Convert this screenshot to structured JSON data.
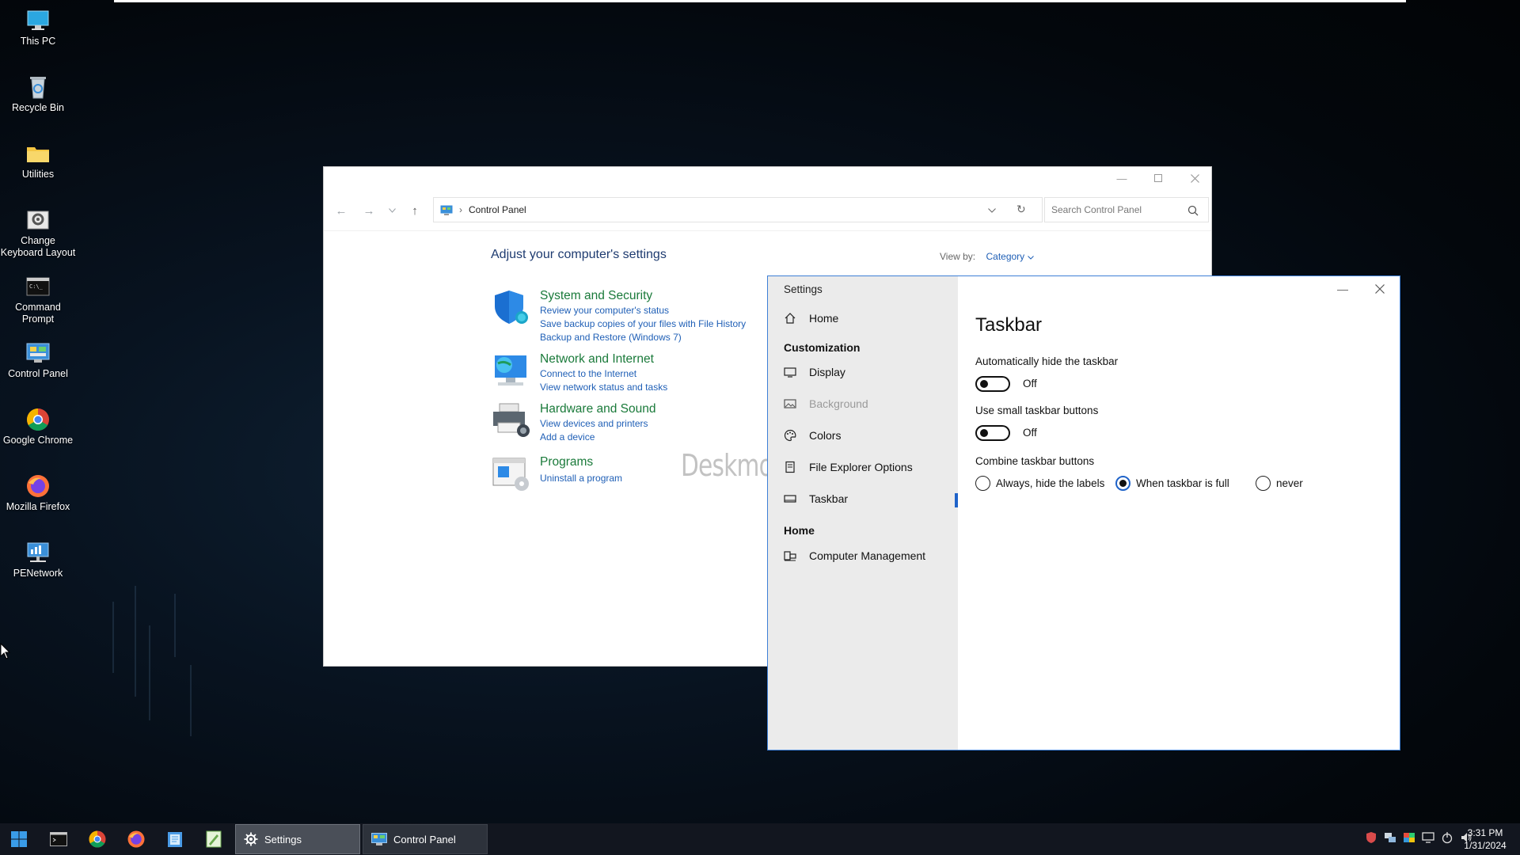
{
  "desktop": {
    "icons": [
      {
        "label": "This PC"
      },
      {
        "label": "Recycle Bin"
      },
      {
        "label": "Utilities"
      },
      {
        "label": "Change Keyboard Layout"
      },
      {
        "label": "Command Prompt"
      },
      {
        "label": "Control Panel"
      },
      {
        "label": "Google Chrome"
      },
      {
        "label": "Mozilla Firefox"
      },
      {
        "label": "PENetwork"
      }
    ]
  },
  "control_panel": {
    "address": "Control Panel",
    "search_placeholder": "Search Control Panel",
    "heading": "Adjust your computer's settings",
    "view_by_label": "View by:",
    "view_by_value": "Category",
    "categories": [
      {
        "title": "System and Security",
        "links": [
          "Review your computer's status",
          "Save backup copies of your files with File History",
          "Backup and Restore (Windows 7)"
        ]
      },
      {
        "title": "Network and Internet",
        "links": [
          "Connect to the Internet",
          "View network status and tasks"
        ]
      },
      {
        "title": "Hardware and Sound",
        "links": [
          "View devices and printers",
          "Add a device"
        ]
      },
      {
        "title": "Programs",
        "links": [
          "Uninstall a program"
        ]
      }
    ]
  },
  "watermark": "Deskmodder.de",
  "settings": {
    "window_title": "Settings",
    "nav": {
      "home": "Home",
      "section_customization": "Customization",
      "display": "Display",
      "background": "Background",
      "colors": "Colors",
      "file_explorer_options": "File Explorer Options",
      "taskbar": "Taskbar",
      "section_home": "Home",
      "computer_management": "Computer Management"
    },
    "page_title": "Taskbar",
    "auto_hide": {
      "label": "Automatically hide the taskbar",
      "state": "Off"
    },
    "small_buttons": {
      "label": "Use small taskbar buttons",
      "state": "Off"
    },
    "combine": {
      "label": "Combine taskbar buttons",
      "options": [
        "Always, hide the labels",
        "When taskbar is full",
        "never"
      ],
      "selected": "When taskbar is full"
    }
  },
  "taskbar": {
    "tasks": [
      {
        "label": "Settings",
        "active": true
      },
      {
        "label": "Control Panel",
        "active": false
      }
    ],
    "clock": {
      "time": "3:31 PM",
      "date": "1/31/2024"
    }
  }
}
